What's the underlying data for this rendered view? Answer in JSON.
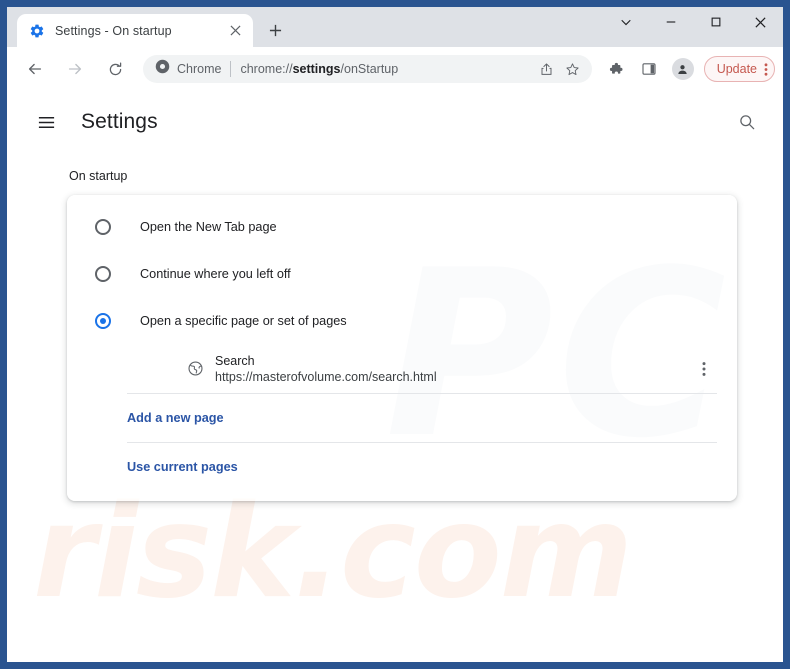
{
  "window": {
    "controls": {
      "chevron_down": "chevron-down",
      "minimize": "minimize",
      "maximize": "maximize",
      "close": "close"
    }
  },
  "tabstrip": {
    "tabs": [
      {
        "title": "Settings - On startup",
        "favicon": "gear-icon",
        "close_label": "×"
      }
    ],
    "new_tab_label": "+"
  },
  "toolbar": {
    "back": "back-arrow",
    "forward": "forward-arrow",
    "reload": "reload",
    "omnibox": {
      "badge_label": "Chrome",
      "url_prefix": "chrome://",
      "url_bold": "settings",
      "url_suffix": "/onStartup",
      "share_icon": "share-icon",
      "bookmark_icon": "star-icon"
    },
    "extensions_icon": "puzzle-icon",
    "sidepanel_icon": "side-panel-icon",
    "profile_icon": "person-icon",
    "update_label": "Update",
    "update_color": "#c5584f",
    "menu_icon": "three-dot-menu"
  },
  "settings": {
    "menu_icon": "hamburger-icon",
    "title": "Settings",
    "search_icon": "search-icon",
    "section_label": "On startup",
    "options": [
      {
        "label": "Open the New Tab page",
        "selected": false
      },
      {
        "label": "Continue where you left off",
        "selected": false
      },
      {
        "label": "Open a specific page or set of pages",
        "selected": true
      }
    ],
    "startup_pages": [
      {
        "name": "Search",
        "url": "https://masterofvolume.com/search.html",
        "icon": "globe-icon",
        "menu_icon": "three-dot-menu"
      }
    ],
    "actions": [
      {
        "label": "Add a new page"
      },
      {
        "label": "Use current pages"
      }
    ],
    "link_color": "#2b55a6",
    "accent_color": "#1a73e8"
  },
  "watermark": {
    "primary": "PC",
    "secondary": "risk.com"
  }
}
